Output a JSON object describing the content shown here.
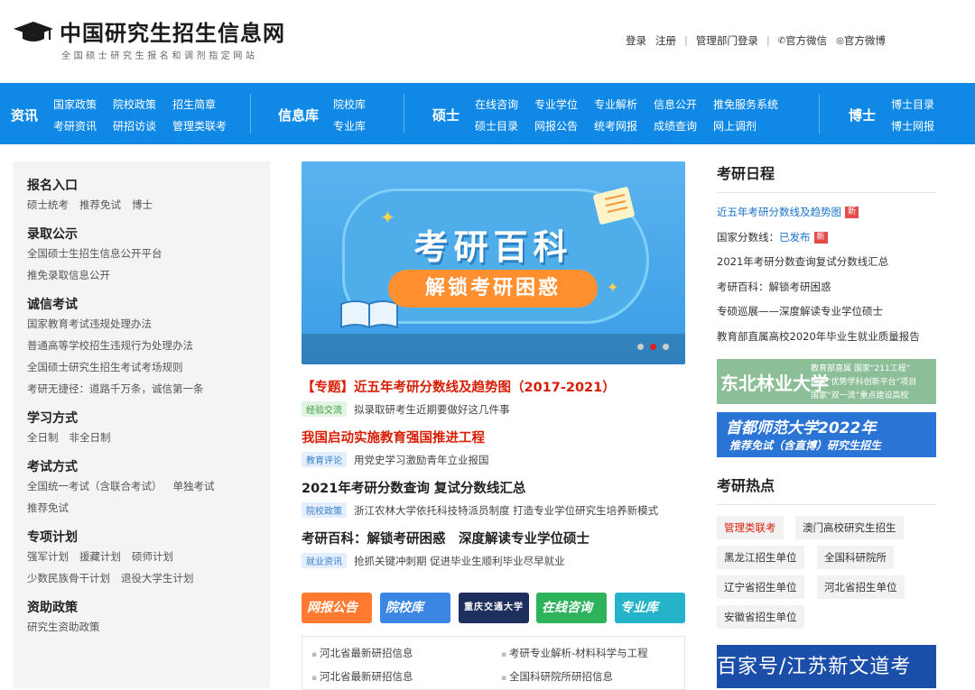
{
  "header": {
    "title": "中国研究生招生信息网",
    "subtitle": "全国硕士研究生报名和调剂指定网站",
    "links": {
      "login": "登录",
      "register": "注册",
      "admin_login": "管理部门登录",
      "wechat": "官方微信",
      "weibo": "官方微博"
    }
  },
  "nav": {
    "zixun": {
      "label": "资讯",
      "links": [
        "国家政策",
        "院校政策",
        "招生简章",
        "考研资讯",
        "研招访谈",
        "管理类联考"
      ]
    },
    "xinxiku": {
      "label": "信息库",
      "links": [
        "院校库",
        "专业库"
      ]
    },
    "shuoshi": {
      "label": "硕士",
      "links": [
        "在线咨询",
        "专业学位",
        "专业解析",
        "信息公开",
        "推免服务系统",
        "硕士目录",
        "网报公告",
        "统考网报",
        "成绩查询",
        "网上调剂"
      ]
    },
    "boshi": {
      "label": "博士",
      "links": [
        "博士目录",
        "博士网报"
      ]
    }
  },
  "left": {
    "sections": [
      {
        "title": "报名入口",
        "lines": [
          [
            "硕士统考",
            "推荐免试",
            "博士"
          ]
        ]
      },
      {
        "title": "录取公示",
        "lines": [
          [
            "全国硕士生招生信息公开平台"
          ],
          [
            "推免录取信息公开"
          ]
        ]
      },
      {
        "title": "诚信考试",
        "lines": [
          [
            "国家教育考试违规处理办法"
          ],
          [
            "普通高等学校招生违规行为处理办法"
          ],
          [
            "全国硕士研究生招生考试考场规则"
          ],
          [
            "考研无捷径：道路千万条，诚信第一条"
          ]
        ]
      },
      {
        "title": "学习方式",
        "lines": [
          [
            "全日制",
            "非全日制"
          ]
        ]
      },
      {
        "title": "考试方式",
        "lines": [
          [
            "全国统一考试（含联合考试）",
            "单独考试"
          ],
          [
            "推荐免试"
          ]
        ]
      },
      {
        "title": "专项计划",
        "lines": [
          [
            "强军计划",
            "援藏计划",
            "硕师计划"
          ],
          [
            "少数民族骨干计划",
            "退役大学生计划"
          ]
        ]
      },
      {
        "title": "资助政策",
        "lines": [
          [
            "研究生资助政策"
          ]
        ]
      }
    ]
  },
  "banner": {
    "title": "考研百科",
    "subtitle": "解锁考研困惑"
  },
  "center": {
    "items": [
      {
        "headline": "【专题】近五年考研分数线及趋势图（2017-2021）",
        "tag": "经验交流",
        "desc": "拟录取研考生近期要做好这几件事"
      },
      {
        "headline": "我国启动实施教育强国推进工程",
        "tag": "教育评论",
        "desc": "用党史学习激励青年立业报国"
      },
      {
        "headline": "2021年考研分数查询 复试分数线汇总",
        "tag": "院校政策",
        "desc": "浙江农林大学依托科技特派员制度 打造专业学位研究生培养新模式"
      },
      {
        "headline": "考研百科：解锁考研困惑　深度解读专业学位硕士",
        "tag": "就业资讯",
        "desc": "抢抓关键冲刺期 促进毕业生顺利毕业尽早就业"
      }
    ],
    "quick_buttons": [
      "网报公告",
      "院校库",
      "专业库",
      "在线咨询",
      "专业库"
    ],
    "info_links": [
      "河北省最新研招信息",
      "考研专业解析-材料科学与工程",
      "河北省最新研招信息",
      "全国科研院所研招信息"
    ]
  },
  "right": {
    "schedule_title": "考研日程",
    "schedule": [
      {
        "text": "近五年考研分数线及趋势图",
        "new": "新"
      },
      {
        "text": "国家分数线：",
        "extra": "已发布",
        "new": "新"
      },
      {
        "text": "2021年考研分数查询复试分数线汇总"
      },
      {
        "text": "考研百科：解锁考研困惑"
      },
      {
        "text": "专硕巡展——深度解读专业学位硕士"
      },
      {
        "text": "教育部直属高校2020年毕业生就业质量报告"
      }
    ],
    "banner1": {
      "name": "东北林业大学",
      "line1": "教育部直属 国家“211工程”",
      "line2": "国家“优势学科创新平台”项目",
      "line3": "国家“双一流”重点建设高校"
    },
    "banner2": {
      "name": "首都师范大学2022年",
      "line1": "推荐免试（含直博）研究生招生"
    },
    "hot_title": "考研热点",
    "hot": [
      "管理类联考",
      "澳门高校研究生招生",
      "黑龙江招生单位",
      "全国科研院所",
      "辽宁省招生单位",
      "河北省招生单位",
      "安徽省招生单位"
    ],
    "watermark": "百家号/江苏新文道考"
  },
  "colors": {
    "nav_blue": "#1089e6",
    "accent_red": "#d81e06"
  }
}
